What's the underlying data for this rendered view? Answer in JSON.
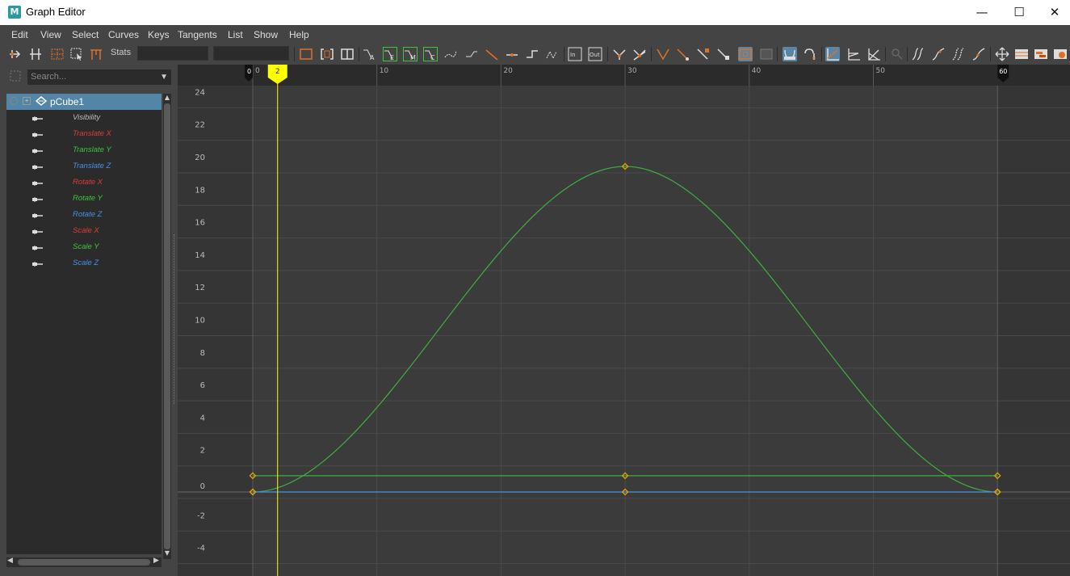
{
  "window": {
    "title": "Graph Editor",
    "app_icon_letter": "M",
    "minimize": "—",
    "maximize": "☐",
    "close": "✕"
  },
  "menu": [
    "Edit",
    "View",
    "Select",
    "Curves",
    "Keys",
    "Tangents",
    "List",
    "Show",
    "Help"
  ],
  "toolbar": {
    "stats_label": "Stats",
    "stats_value_1": "",
    "stats_value_2": ""
  },
  "outliner": {
    "search_placeholder": "Search...",
    "root": "pCube1",
    "channels": [
      {
        "label": "Visibility",
        "color": "#bbbbbb"
      },
      {
        "label": "Translate X",
        "color": "#e03a3a"
      },
      {
        "label": "Translate Y",
        "color": "#3fc23f"
      },
      {
        "label": "Translate Z",
        "color": "#4a8fe8"
      },
      {
        "label": "Rotate X",
        "color": "#e03a3a"
      },
      {
        "label": "Rotate Y",
        "color": "#3fc23f"
      },
      {
        "label": "Rotate Z",
        "color": "#4a8fe8"
      },
      {
        "label": "Scale X",
        "color": "#e03a3a"
      },
      {
        "label": "Scale Y",
        "color": "#3fc23f"
      },
      {
        "label": "Scale Z",
        "color": "#4a8fe8"
      }
    ]
  },
  "graph": {
    "timeline": {
      "start_label": "0",
      "end_label": "60",
      "current_frame": "2",
      "ticks": [
        "0",
        "10",
        "20",
        "30",
        "40",
        "50"
      ]
    },
    "y_ticks": [
      "24",
      "22",
      "20",
      "18",
      "16",
      "14",
      "12",
      "10",
      "8",
      "6",
      "4",
      "2",
      "0",
      "-2",
      "-4"
    ],
    "colors": {
      "background": "#3b3b3b",
      "grid": "#4a4a4a",
      "curve_green": "#3fae3f",
      "curve_blue": "#4a8fe8",
      "key": "#e0a000",
      "current_time": "#ffff00"
    }
  },
  "chart_data": {
    "type": "line",
    "x_range": [
      0,
      60
    ],
    "ylim": [
      -4,
      24
    ],
    "series": [
      {
        "values_x": [
          0,
          30,
          60
        ],
        "values_y": [
          0,
          20,
          0
        ],
        "interp": "spline"
      },
      {
        "values_x": [
          0,
          30,
          60
        ],
        "values_y": [
          1,
          1,
          1
        ],
        "interp": "linear"
      },
      {
        "values_x": [
          0,
          30,
          60
        ],
        "values_y": [
          0,
          0,
          0
        ],
        "interp": "linear"
      }
    ],
    "current_frame": 2
  }
}
